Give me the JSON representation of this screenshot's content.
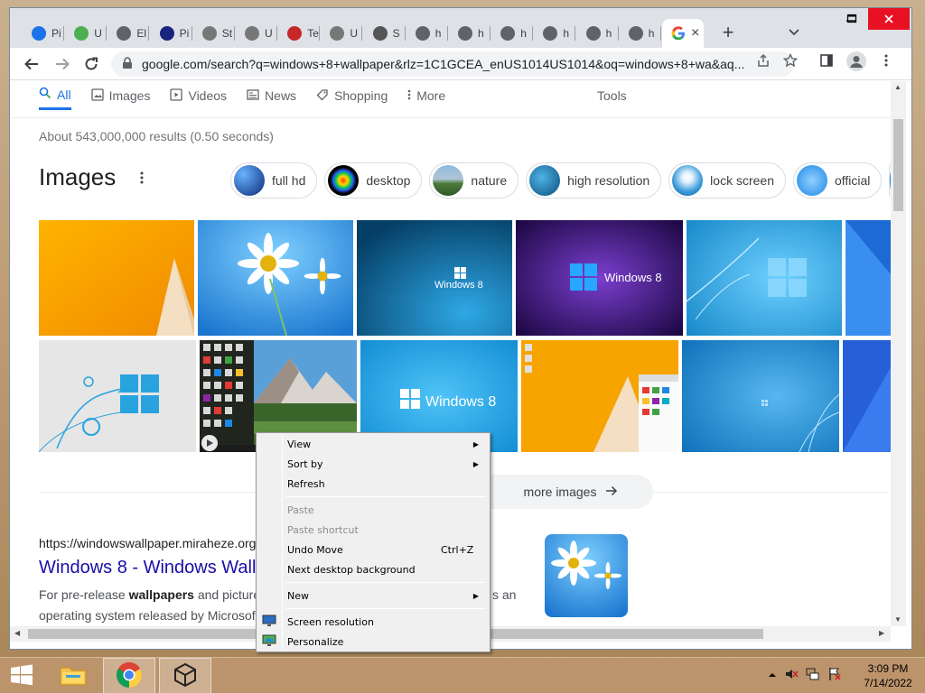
{
  "browser": {
    "tabs": [
      {
        "title": "Pi",
        "icon": "edge-icon",
        "color": "#1a73e8"
      },
      {
        "title": "U",
        "icon": "pen-icon",
        "color": "#4caf50"
      },
      {
        "title": "El",
        "icon": "globe-icon",
        "color": "#5f6368"
      },
      {
        "title": "Pi",
        "icon": "big-fish-icon",
        "color": "#1a237e"
      },
      {
        "title": "St",
        "icon": "unity-icon",
        "color": "#777"
      },
      {
        "title": "U",
        "icon": "unity-icon",
        "color": "#777"
      },
      {
        "title": "Te",
        "icon": "mail-icon",
        "color": "#c62828"
      },
      {
        "title": "U",
        "icon": "unity-icon",
        "color": "#777"
      },
      {
        "title": "S",
        "icon": "gear-icon",
        "color": "#555"
      },
      {
        "title": "h",
        "icon": "globe-icon",
        "color": "#5f6368"
      },
      {
        "title": "h",
        "icon": "globe-icon",
        "color": "#5f6368"
      },
      {
        "title": "h",
        "icon": "globe-icon",
        "color": "#5f6368"
      },
      {
        "title": "h",
        "icon": "globe-icon",
        "color": "#5f6368"
      },
      {
        "title": "h",
        "icon": "globe-icon",
        "color": "#5f6368"
      },
      {
        "title": "h",
        "icon": "globe-icon",
        "color": "#5f6368"
      }
    ],
    "active_tab": {
      "title": "×",
      "icon": "google-icon"
    },
    "new_tab": "+",
    "url": "google.com/search?q=windows+8+wallpaper&rlz=1C1GCEA_enUS1014US1014&oq=windows+8+wa&aq..."
  },
  "search": {
    "tabs": [
      {
        "label": "All",
        "icon": "search-icon"
      },
      {
        "label": "Images",
        "icon": "image-icon"
      },
      {
        "label": "Videos",
        "icon": "video-icon"
      },
      {
        "label": "News",
        "icon": "news-icon"
      },
      {
        "label": "Shopping",
        "icon": "tag-icon"
      },
      {
        "label": "More",
        "icon": "more-icon"
      }
    ],
    "tools": "Tools",
    "results_count": "About 543,000,000 results (0.50 seconds)",
    "images_heading": "Images",
    "chips": [
      "full hd",
      "desktop",
      "nature",
      "high resolution",
      "lock screen",
      "official"
    ],
    "more_images": "more images",
    "result": {
      "url": "https://windowswallpaper.miraheze.org",
      "title": "Windows 8 - Windows Wall",
      "snippet_line1_pre": "For pre-release ",
      "snippet_bold": "wallpapers",
      "snippet_line1_post": " and picture",
      "snippet_trail": "s an",
      "snippet_line2": "operating system released by Microsof"
    },
    "windows8_label": "Windows 8"
  },
  "context_menu": {
    "items": [
      {
        "label": "View",
        "submenu": true,
        "disabled": false
      },
      {
        "label": "Sort by",
        "submenu": true,
        "disabled": false
      },
      {
        "label": "Refresh",
        "submenu": false,
        "disabled": false
      },
      {
        "label": "Paste",
        "submenu": false,
        "disabled": true
      },
      {
        "label": "Paste shortcut",
        "submenu": false,
        "disabled": true
      },
      {
        "label": "Undo Move",
        "shortcut": "Ctrl+Z",
        "submenu": false,
        "disabled": false
      },
      {
        "label": "Next desktop background",
        "submenu": false,
        "disabled": false
      },
      {
        "label": "New",
        "submenu": true,
        "disabled": false
      },
      {
        "label": "Screen resolution",
        "submenu": false,
        "disabled": false,
        "icon": "monitor-icon"
      },
      {
        "label": "Personalize",
        "submenu": false,
        "disabled": false,
        "icon": "personalize-icon"
      }
    ]
  },
  "taskbar": {
    "time": "3:09 PM",
    "date": "7/14/2022"
  }
}
